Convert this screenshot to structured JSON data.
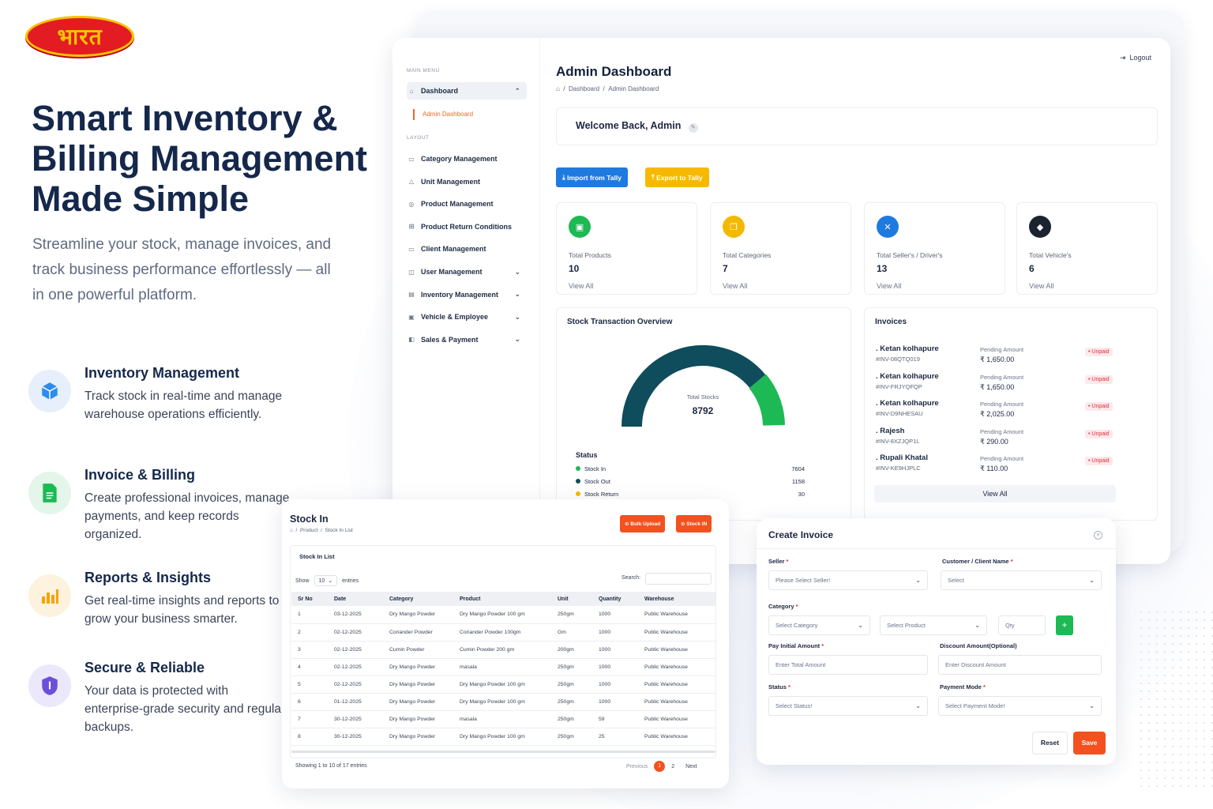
{
  "brand": {
    "logo_text": "भारत"
  },
  "hero": {
    "title": "Smart Inventory & Billing Management Made Simple",
    "subtitle": "Streamline your stock, manage invoices, and track business performance effortlessly — all in one powerful platform."
  },
  "features": [
    {
      "title": "Inventory Management",
      "text": "Track stock in real-time and manage warehouse operations efficiently."
    },
    {
      "title": "Invoice & Billing",
      "text": "Create professional invoices, manage payments, and keep records organized."
    },
    {
      "title": "Reports & Insights",
      "text": "Get real-time insights and reports to grow your business smarter."
    },
    {
      "title": "Secure & Reliable",
      "text": "Your data is protected with enterprise-grade security and regular backups."
    }
  ],
  "dashboard": {
    "sidebar": {
      "main_menu_label": "MAIN MENU",
      "dashboard_label": "Dashboard",
      "admin_dashboard_label": "Admin Dashboard",
      "layout_label": "LAYOUT",
      "items": [
        {
          "label": "Category Management",
          "icon": "tag-icon",
          "chevron": false
        },
        {
          "label": "Unit Management",
          "icon": "triangle-icon",
          "chevron": false
        },
        {
          "label": "Product Management",
          "icon": "box-icon",
          "chevron": false
        },
        {
          "label": "Product Return Conditions",
          "icon": "grid-icon",
          "chevron": false
        },
        {
          "label": "Client Management",
          "icon": "folder-icon",
          "chevron": false
        },
        {
          "label": "User Management",
          "icon": "users-icon",
          "chevron": true
        },
        {
          "label": "Inventory Management",
          "icon": "archive-icon",
          "chevron": true
        },
        {
          "label": "Vehicle & Employee",
          "icon": "truck-icon",
          "chevron": true
        },
        {
          "label": "Sales & Payment",
          "icon": "wallet-icon",
          "chevron": true
        }
      ]
    },
    "title": "Admin Dashboard",
    "breadcrumb": {
      "first": "Dashboard",
      "second": "Admin Dashboard"
    },
    "logout_label": "Logout",
    "welcome": "Welcome Back, Admin",
    "import_label": "Import from Tally",
    "export_label": "Export to Tally",
    "stats": [
      {
        "label": "Total Products",
        "value": "10",
        "link": "View All",
        "color": "#1db954"
      },
      {
        "label": "Total Categories",
        "value": "7",
        "link": "View All",
        "color": "#f5b800"
      },
      {
        "label": "Total Seller's / Driver's",
        "value": "13",
        "link": "View All",
        "color": "#1f7ae0"
      },
      {
        "label": "Total Vehicle's",
        "value": "6",
        "link": "View All",
        "color": "#1b2230"
      }
    ],
    "stock_overview": {
      "title": "Stock Transaction Overview",
      "center_label": "Total Stocks",
      "center_value": "8792",
      "status_label": "Status",
      "legend": [
        {
          "label": "Stock In",
          "value": "7604",
          "color": "#1db954"
        },
        {
          "label": "Stock Out",
          "value": "1158",
          "color": "#0f4c5c"
        },
        {
          "label": "Stock Return",
          "value": "30",
          "color": "#f5b800"
        }
      ]
    },
    "invoices": {
      "title": "Invoices",
      "pending_label": "Pending Amount",
      "badge": "• Unpaid",
      "rows": [
        {
          "name": ". Ketan kolhapure",
          "id": "#INV-08QTQ019",
          "amount": "₹ 1,650.00"
        },
        {
          "name": ". Ketan kolhapure",
          "id": "#INV-FRJYQFQP",
          "amount": "₹ 1,650.00"
        },
        {
          "name": ". Ketan kolhapure",
          "id": "#INV-D9NHESAU",
          "amount": "₹ 2,025.00"
        },
        {
          "name": ". Rajesh",
          "id": "#INV-8XZJQP1L",
          "amount": "₹ 290.00"
        },
        {
          "name": ". Rupali Khatal",
          "id": "#INV-KE9HJPLC",
          "amount": "₹ 110.00"
        }
      ],
      "view_all": "View All"
    }
  },
  "stock_in": {
    "title": "Stock In",
    "crumb_first": "Product",
    "crumb_second": "Stock In List",
    "bulk_upload": "Bulk Upload",
    "stock_in_btn": "Stock IN",
    "list_title": "Stock In List",
    "show_label": "Show",
    "show_value": "10",
    "entries_label": "entries",
    "search_label": "Search:",
    "columns": [
      "Sr No",
      "Date",
      "Category",
      "Product",
      "Unit",
      "Quantity",
      "Warehouse"
    ],
    "rows": [
      [
        "1",
        "03-12-2025",
        "Dry Mango Powder",
        "Dry Mango Powder 100 gm",
        "250gm",
        "1000",
        "Public Warehouse"
      ],
      [
        "2",
        "02-12-2025",
        "Coriander Powder",
        "Coriander Powder 100gm",
        "Gm",
        "1000",
        "Public Warehouse"
      ],
      [
        "3",
        "02-12-2025",
        "Cumin Powder",
        "Cumin Powder 200 gm",
        "200gm",
        "1000",
        "Public Warehouse"
      ],
      [
        "4",
        "02-12-2025",
        "Dry Mango Powder",
        "masala",
        "250gm",
        "1000",
        "Public Warehouse"
      ],
      [
        "5",
        "02-12-2025",
        "Dry Mango Powder",
        "Dry Mango Powder 100 gm",
        "250gm",
        "1000",
        "Public Warehouse"
      ],
      [
        "6",
        "01-12-2025",
        "Dry Mango Powder",
        "Dry Mango Powder 100 gm",
        "250gm",
        "1000",
        "Public Warehouse"
      ],
      [
        "7",
        "30-12-2025",
        "Dry Mango Powder",
        "masala",
        "250gm",
        "59",
        "Public Warehouse"
      ],
      [
        "8",
        "30-12-2025",
        "Dry Mango Powder",
        "Dry Mango Powder 100 gm",
        "250gm",
        "25",
        "Public Warehouse"
      ]
    ],
    "footer": "Showing 1 to 10 of 17 entries",
    "prev": "Previous",
    "page1": "1",
    "page2": "2",
    "next": "Next"
  },
  "create_invoice": {
    "title": "Create Invoice",
    "seller_label": "Seller",
    "seller_placeholder": "Please Select Seller!",
    "customer_label": "Customer / Client Name",
    "customer_placeholder": "Select",
    "category_label": "Category",
    "category_placeholder": "Select Category",
    "product_placeholder": "Select Product",
    "qty_placeholder": "Qty",
    "add_btn": "+",
    "pay_label": "Pay Initial Amount",
    "pay_placeholder": "Enter Total Amount",
    "discount_label": "Discount Amount(Optional)",
    "discount_placeholder": "Enter Discount Amount",
    "status_label": "Status",
    "status_placeholder": "Select Status!",
    "payment_label": "Payment Mode",
    "payment_placeholder": "Select Payment Mode!",
    "reset": "Reset",
    "save": "Save",
    "req": "*"
  }
}
